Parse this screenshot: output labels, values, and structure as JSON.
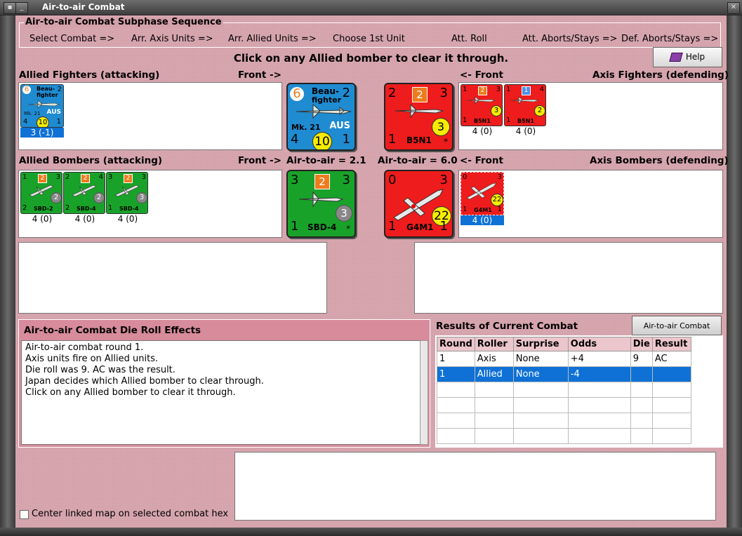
{
  "window": {
    "title": "Air-to-air Combat"
  },
  "sequence": {
    "label": "Air-to-air Combat Subphase Sequence",
    "steps": [
      "Select Combat =>",
      "Arr. Axis Units =>",
      "Arr. Allied Units =>",
      "Choose 1st Unit",
      "Att. Roll",
      "Att. Aborts/Stays =>",
      "Def. Aborts/Stays =>"
    ]
  },
  "instruction": "Click on any Allied bomber to clear it through.",
  "help_label": "Help",
  "fighters": {
    "allied_label": "Allied Fighters (attacking)",
    "front_right": "Front ->",
    "front_left": "<- Front",
    "axis_label": "Axis Fighters (defending)"
  },
  "bombers": {
    "allied_label": "Allied Bombers (attacking)",
    "front_right": "Front ->",
    "air_left": "Air-to-air = 2.1",
    "air_right": "Air-to-air = 6.0",
    "front_left": "<- Front",
    "axis_label": "Axis Bombers (defending)"
  },
  "allied_fighter_units": [
    {
      "name": "Beau-fighter",
      "model": "Mk. 21",
      "nation": "AUS",
      "tl": "6",
      "tr": "2",
      "bl": "4",
      "br": "1",
      "circle": "10",
      "value": "3 (-1)"
    }
  ],
  "axis_fighter_units": [
    {
      "name": "B5N1",
      "tl": "1",
      "box": "2",
      "tr": "3",
      "bl": "1",
      "circle": "3",
      "value": "4 (0)"
    },
    {
      "name": "B5N1",
      "tl": "1",
      "box": "1",
      "tr": "4",
      "bl": "1",
      "circle": "2",
      "value": "4 (0)"
    }
  ],
  "allied_bomber_units": [
    {
      "name": "SBD-2",
      "tl": "1",
      "box": "2",
      "tr": "3",
      "bl": "2",
      "circle": "2",
      "value": "4 (0)"
    },
    {
      "name": "SBD-4",
      "tl": "2",
      "box": "2",
      "tr": "4",
      "bl": "2",
      "circle": "2",
      "value": "4 (0)"
    },
    {
      "name": "SBD-4",
      "tl": "3",
      "box": "2",
      "tr": "3",
      "bl": "1",
      "circle": "3",
      "value": "4 (0)"
    }
  ],
  "axis_bomber_units": [
    {
      "name": "G4M1",
      "tl": "0",
      "tr": "3",
      "bl": "1",
      "br": "1",
      "circle": "22",
      "value": "4 (0)"
    }
  ],
  "big_counters": {
    "beaufighter": {
      "name1": "Beau-",
      "name2": "fighter",
      "model": "Mk. 21",
      "nation": "AUS",
      "tl": "6",
      "tr": "2",
      "bl": "4",
      "br": "1",
      "circle": "10"
    },
    "b5n1": {
      "name": "B5N1",
      "tl": "2",
      "box": "2",
      "tr": "3",
      "bl": "1",
      "circle": "3",
      "star": "*"
    },
    "sbd4": {
      "name": "SBD-4",
      "tl": "3",
      "box": "2",
      "tr": "3",
      "bl": "1",
      "circle": "3",
      "star": "*"
    },
    "g4m1": {
      "name": "G4M1",
      "tl": "0",
      "tr": "3",
      "bl": "1",
      "br": "1",
      "circle": "22"
    }
  },
  "effects": {
    "label": "Air-to-air Combat Die Roll Effects",
    "lines": [
      "Air-to-air combat round 1.",
      "Axis units fire on Allied units.",
      "Die roll was 9.  AC was the result.",
      "Japan decides which Allied bomber to clear through.",
      "Click on any Allied bomber to clear it through."
    ]
  },
  "results": {
    "label": "Results of Current Combat",
    "chart_button": "Air-to-air Combat Chart",
    "columns": [
      "Round",
      "Roller",
      "Surprise",
      "Odds",
      "Die",
      "Result"
    ],
    "rows": [
      [
        "1",
        "Axis",
        "None",
        "+4",
        "9",
        "AC"
      ],
      [
        "1",
        "Allied",
        "None",
        "-4",
        "",
        ""
      ]
    ]
  },
  "center_map_label": "Center linked map on selected combat hex",
  "colors": {
    "allied_fighter": "#1f8bd1",
    "axis": "#ee1c1c",
    "allied_bomber": "#19a22a",
    "selection": "#0f71d6",
    "background": "#d4a1aa"
  }
}
